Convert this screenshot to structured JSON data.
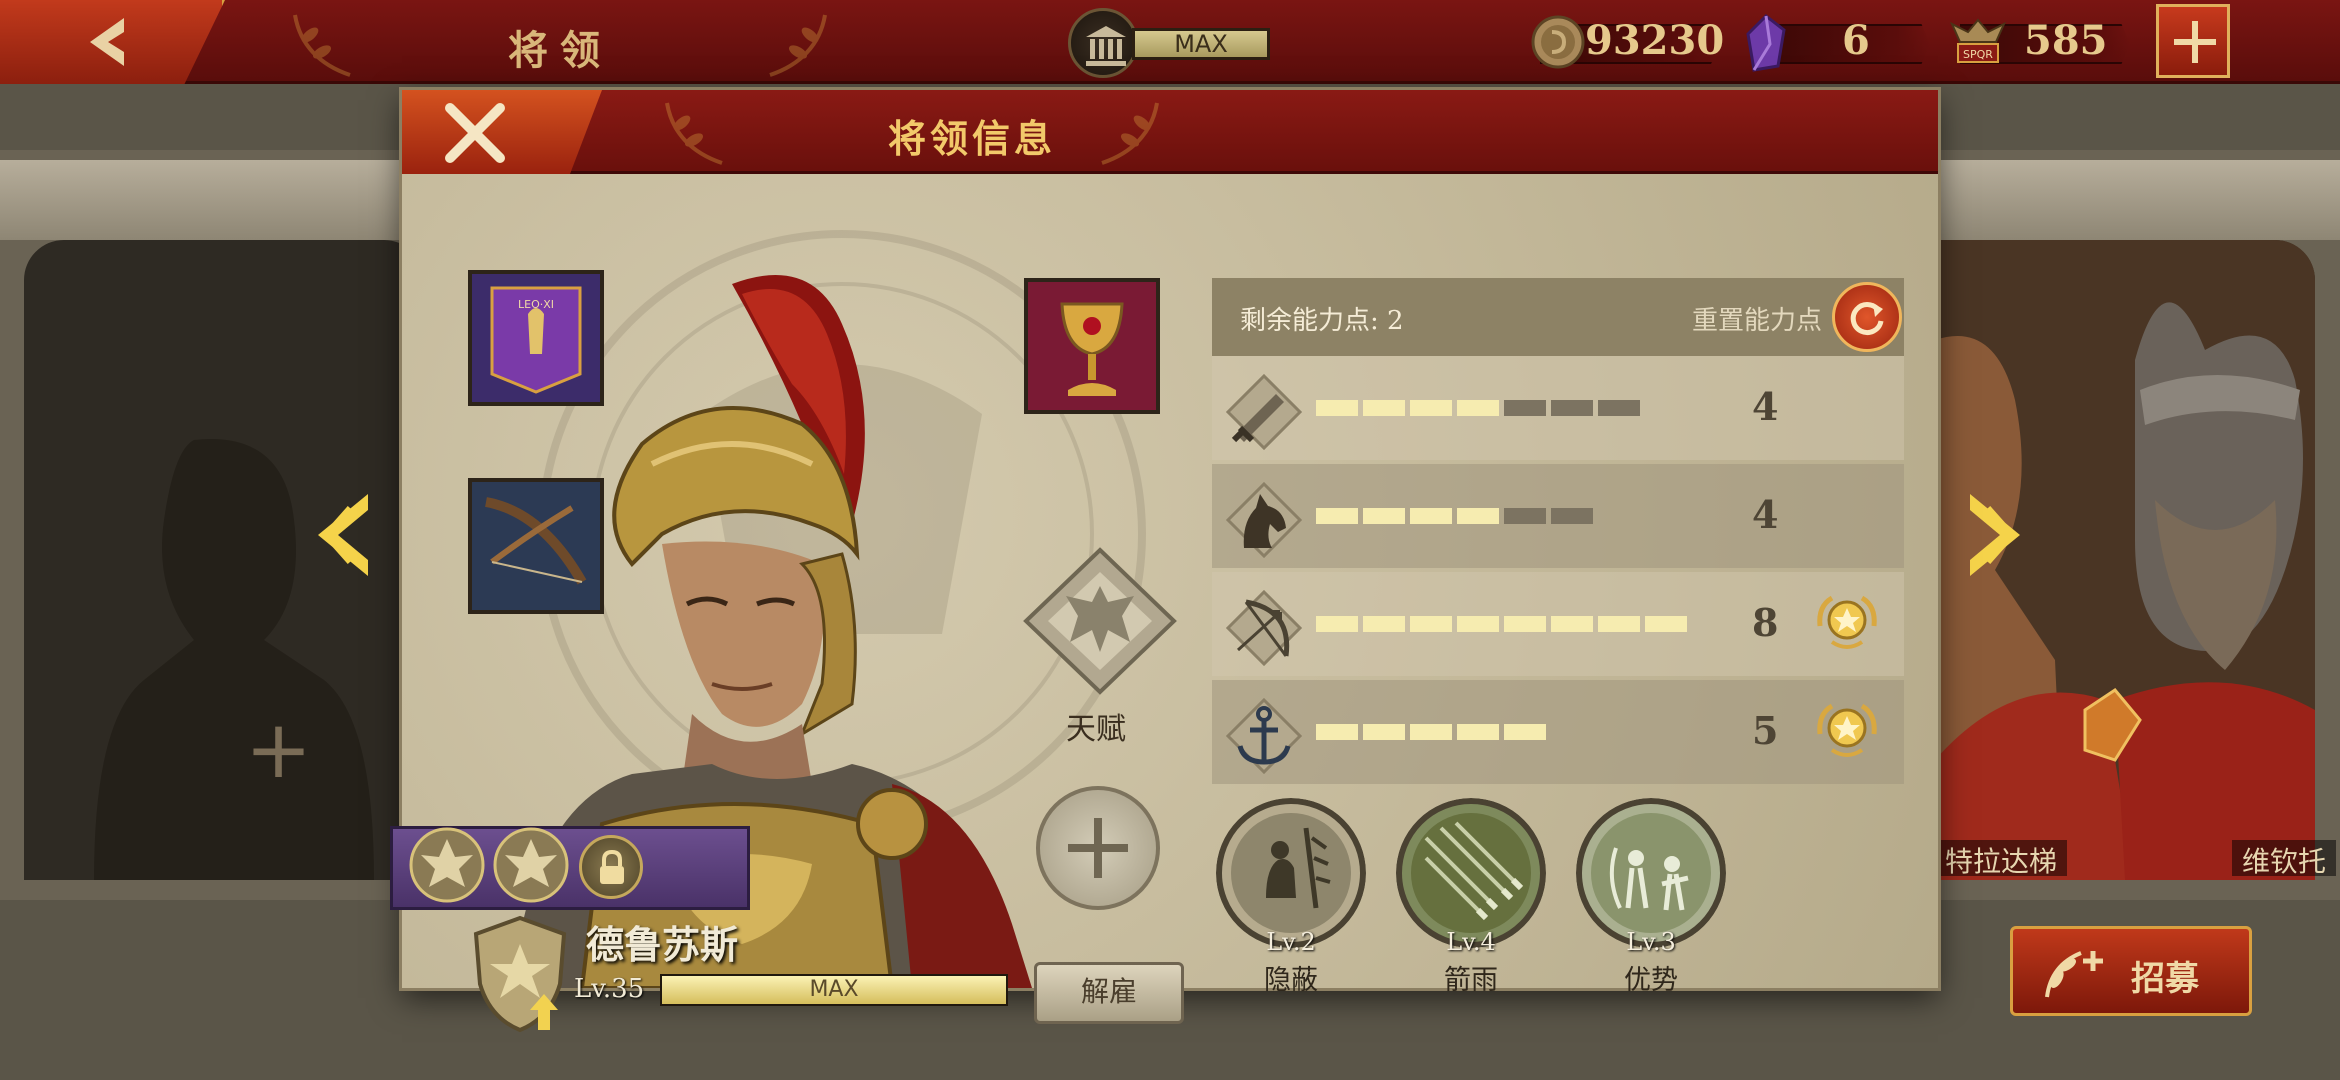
{
  "topbar": {
    "title": "将领",
    "building_level": "MAX",
    "coins": "93230",
    "gems": "6",
    "spqr": "585"
  },
  "dialog": {
    "title": "将领信息",
    "talent_label": "天赋",
    "hero": {
      "name": "德鲁苏斯",
      "level": "Lv.35",
      "xp_text": "MAX",
      "xp_fraction": 1.0
    },
    "dismiss_label": "解雇",
    "points_label": "剩余能力点: 2",
    "reset_label": "重置能力点",
    "stats": [
      {
        "icon": "sword-icon",
        "filled": 4,
        "total": 7,
        "value": "4",
        "medal": false
      },
      {
        "icon": "horse-icon",
        "filled": 4,
        "total": 6,
        "value": "4",
        "medal": false
      },
      {
        "icon": "bow-icon",
        "filled": 8,
        "total": 8,
        "value": "8",
        "medal": true
      },
      {
        "icon": "anchor-icon",
        "filled": 5,
        "total": 5,
        "value": "5",
        "medal": true
      }
    ],
    "skills": [
      {
        "level": "Lv.2",
        "name": "隐蔽"
      },
      {
        "level": "Lv.4",
        "name": "箭雨"
      },
      {
        "level": "Lv.3",
        "name": "优势"
      }
    ]
  },
  "background": {
    "rival_left_name": "特拉达梯",
    "rival_right_name": "维钦托"
  },
  "recruit_label": "招募",
  "colors": {
    "accent_red": "#8a1a14",
    "gold": "#f2c96a",
    "bar_filled": "#f6ecb0",
    "bar_empty": "#7c7361"
  }
}
